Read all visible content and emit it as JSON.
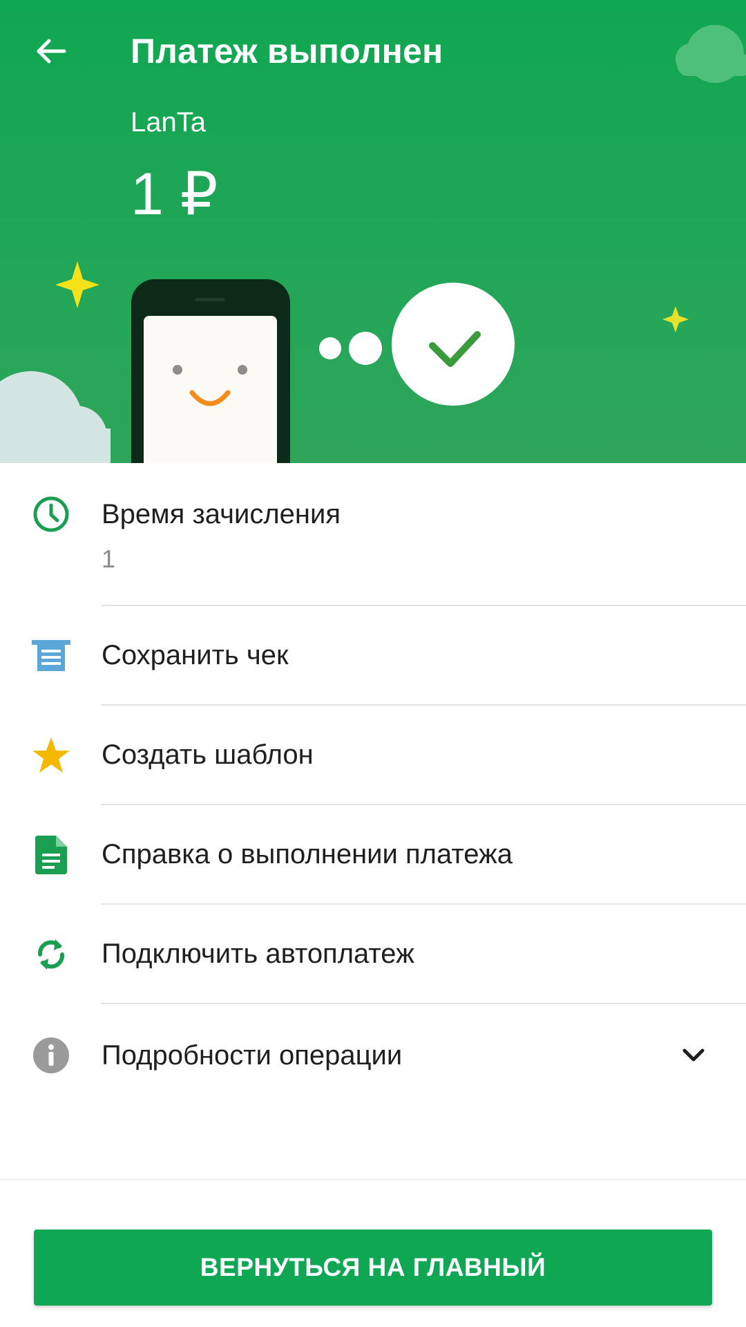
{
  "header": {
    "title": "Платеж выполнен",
    "merchant": "LanTa",
    "amount": "1 ₽",
    "background_color": "#10a752"
  },
  "icons": {
    "back": "arrow-left-icon",
    "time": "clock-icon",
    "receipt": "receipt-icon",
    "template": "star-icon",
    "certificate": "document-icon",
    "autopay": "refresh-icon",
    "details": "info-icon",
    "expand": "chevron-down-icon"
  },
  "list": {
    "time": {
      "label": "Время зачисления",
      "value": "1"
    },
    "items": [
      {
        "label": "Сохранить чек"
      },
      {
        "label": "Создать шаблон"
      },
      {
        "label": "Справка о выполнении платежа"
      },
      {
        "label": "Подключить автоплатеж"
      }
    ],
    "details": {
      "label": "Подробности операции"
    }
  },
  "button": {
    "label": "ВЕРНУТЬСЯ НА ГЛАВНЫЙ",
    "color": "#0fa753"
  },
  "colors": {
    "accent_green": "#0fa753",
    "icon_green": "#1a9e52",
    "receipt_blue": "#5aa7d8",
    "star_yellow": "#f5b800",
    "info_gray": "#9a9a9a"
  }
}
